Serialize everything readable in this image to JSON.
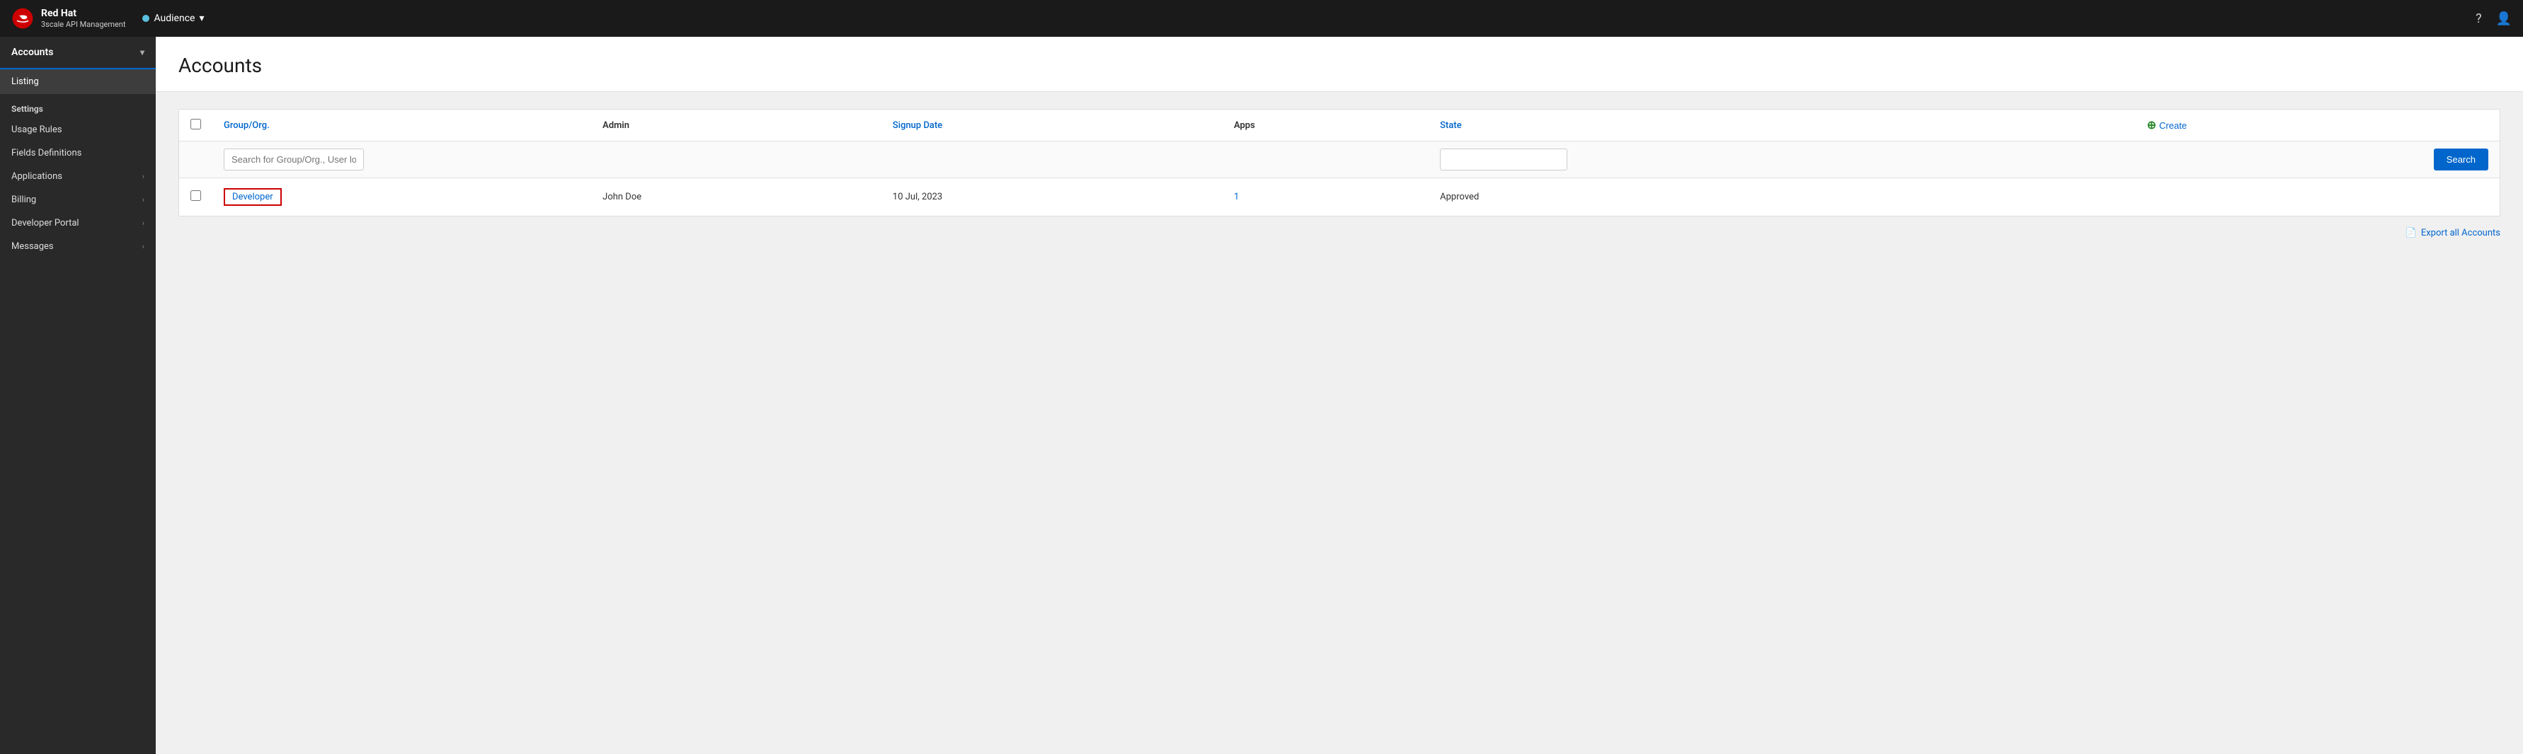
{
  "brand": {
    "name": "Red Hat",
    "subtitle": "3scale API Management"
  },
  "topnav": {
    "audience_label": "Audience",
    "help_icon": "?",
    "user_icon": "👤"
  },
  "sidebar": {
    "accounts_label": "Accounts",
    "listing_label": "Listing",
    "settings_label": "Settings",
    "settings_items": [
      {
        "label": "Usage Rules"
      },
      {
        "label": "Fields Definitions"
      }
    ],
    "nav_items": [
      {
        "label": "Applications"
      },
      {
        "label": "Billing"
      },
      {
        "label": "Developer Portal"
      },
      {
        "label": "Messages"
      }
    ]
  },
  "page": {
    "title": "Accounts",
    "create_label": "Create"
  },
  "table": {
    "columns": [
      {
        "label": "Group/Org.",
        "type": "link"
      },
      {
        "label": "Admin",
        "type": "bold"
      },
      {
        "label": "Signup Date",
        "type": "link"
      },
      {
        "label": "Apps",
        "type": "bold"
      },
      {
        "label": "State",
        "type": "link"
      }
    ],
    "search_placeholder": "Search for Group/Org., User login, First name, Last name, email, user_ke",
    "search_button_label": "Search",
    "rows": [
      {
        "group": "Developer",
        "admin": "John Doe",
        "signup_date": "10 Jul, 2023",
        "apps": "1",
        "state": "Approved"
      }
    ]
  },
  "export": {
    "label": "Export all Accounts"
  }
}
